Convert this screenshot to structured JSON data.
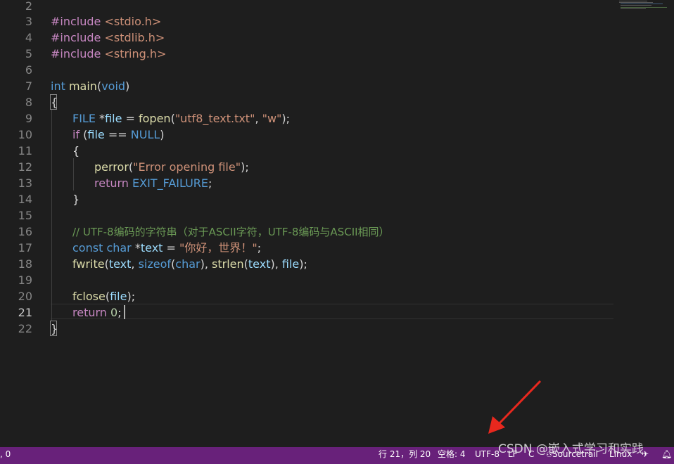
{
  "editor": {
    "line_numbers": [
      "2",
      "3",
      "4",
      "5",
      "6",
      "7",
      "8",
      "9",
      "10",
      "11",
      "12",
      "13",
      "14",
      "15",
      "16",
      "17",
      "18",
      "19",
      "20",
      "21",
      "22"
    ],
    "active_line": "21",
    "lines": {
      "l3": {
        "inc": "#include",
        "hdr": " <stdio.h>"
      },
      "l4": {
        "inc": "#include",
        "hdr": " <stdlib.h>"
      },
      "l5": {
        "inc": "#include",
        "hdr": " <string.h>"
      },
      "l7": {
        "type": "int",
        "sp": " ",
        "func": "main",
        "p1": "(",
        "arg": "void",
        "p2": ")"
      },
      "l8": {
        "brace": "{"
      },
      "l9": {
        "type": "FILE",
        "p1": " *",
        "var": "file",
        "p2": " = ",
        "func": "fopen",
        "p3": "(",
        "s1": "\"utf8_text.txt\"",
        "p4": ", ",
        "s2": "\"w\"",
        "p5": ");"
      },
      "l10": {
        "kw": "if",
        "p1": " (",
        "var": "file",
        "p2": " == ",
        "const": "NULL",
        "p3": ")"
      },
      "l11": {
        "brace": "{"
      },
      "l12": {
        "func": "perror",
        "p1": "(",
        "s1": "\"Error opening file\"",
        "p2": ");"
      },
      "l13": {
        "kw": "return",
        "sp": " ",
        "macro": "EXIT_FAILURE",
        "p1": ";"
      },
      "l14": {
        "brace": "}"
      },
      "l16": {
        "comment": "// UTF-8编码的字符串（对于ASCII字符，UTF-8编码与ASCII相同）"
      },
      "l17": {
        "t1": "const",
        "sp1": " ",
        "t2": "char",
        "p1": " *",
        "var": "text",
        "p2": " = ",
        "s1": "\"你好，世界！\"",
        "p3": ";"
      },
      "l18": {
        "func": "fwrite",
        "p1": "(",
        "v1": "text",
        "p2": ", ",
        "kw": "sizeof",
        "p3": "(",
        "t1": "char",
        "p4": "), ",
        "f2": "strlen",
        "p5": "(",
        "v2": "text",
        "p6": "), ",
        "v3": "file",
        "p7": ");"
      },
      "l20": {
        "func": "fclose",
        "p1": "(",
        "var": "file",
        "p2": ");"
      },
      "l21": {
        "kw": "return",
        "sp": " ",
        "num": "0",
        "p1": ";"
      },
      "l22": {
        "brace": "}"
      }
    }
  },
  "statusbar": {
    "left_text": ", 0",
    "position": "行 21，列 20",
    "spaces": "空格: 4",
    "encoding": "UTF-8",
    "eol": "LF",
    "language": "C",
    "extension": "Sourcetrail",
    "platform": "Linux",
    "color": "#68217a"
  },
  "watermark": {
    "text": "CSDN @嵌入式学习和实践"
  },
  "annotation": {
    "arrow_color": "#e8281e"
  }
}
